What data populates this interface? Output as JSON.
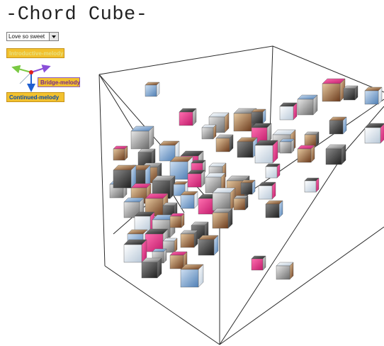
{
  "page": {
    "title": "-Chord Cube-"
  },
  "song_selector": {
    "selected": "Love so sweet"
  },
  "legend": {
    "introductive": "Introductive-melody",
    "bridge": "Bridge-melody",
    "continued": "Continued-melody",
    "colors": {
      "introductive": "#7ac943",
      "bridge": "#8a4fd8",
      "continued": "#1f5fd1",
      "origin": "#e0201e"
    }
  },
  "cube": {
    "label": "3D chord cube viewport"
  }
}
